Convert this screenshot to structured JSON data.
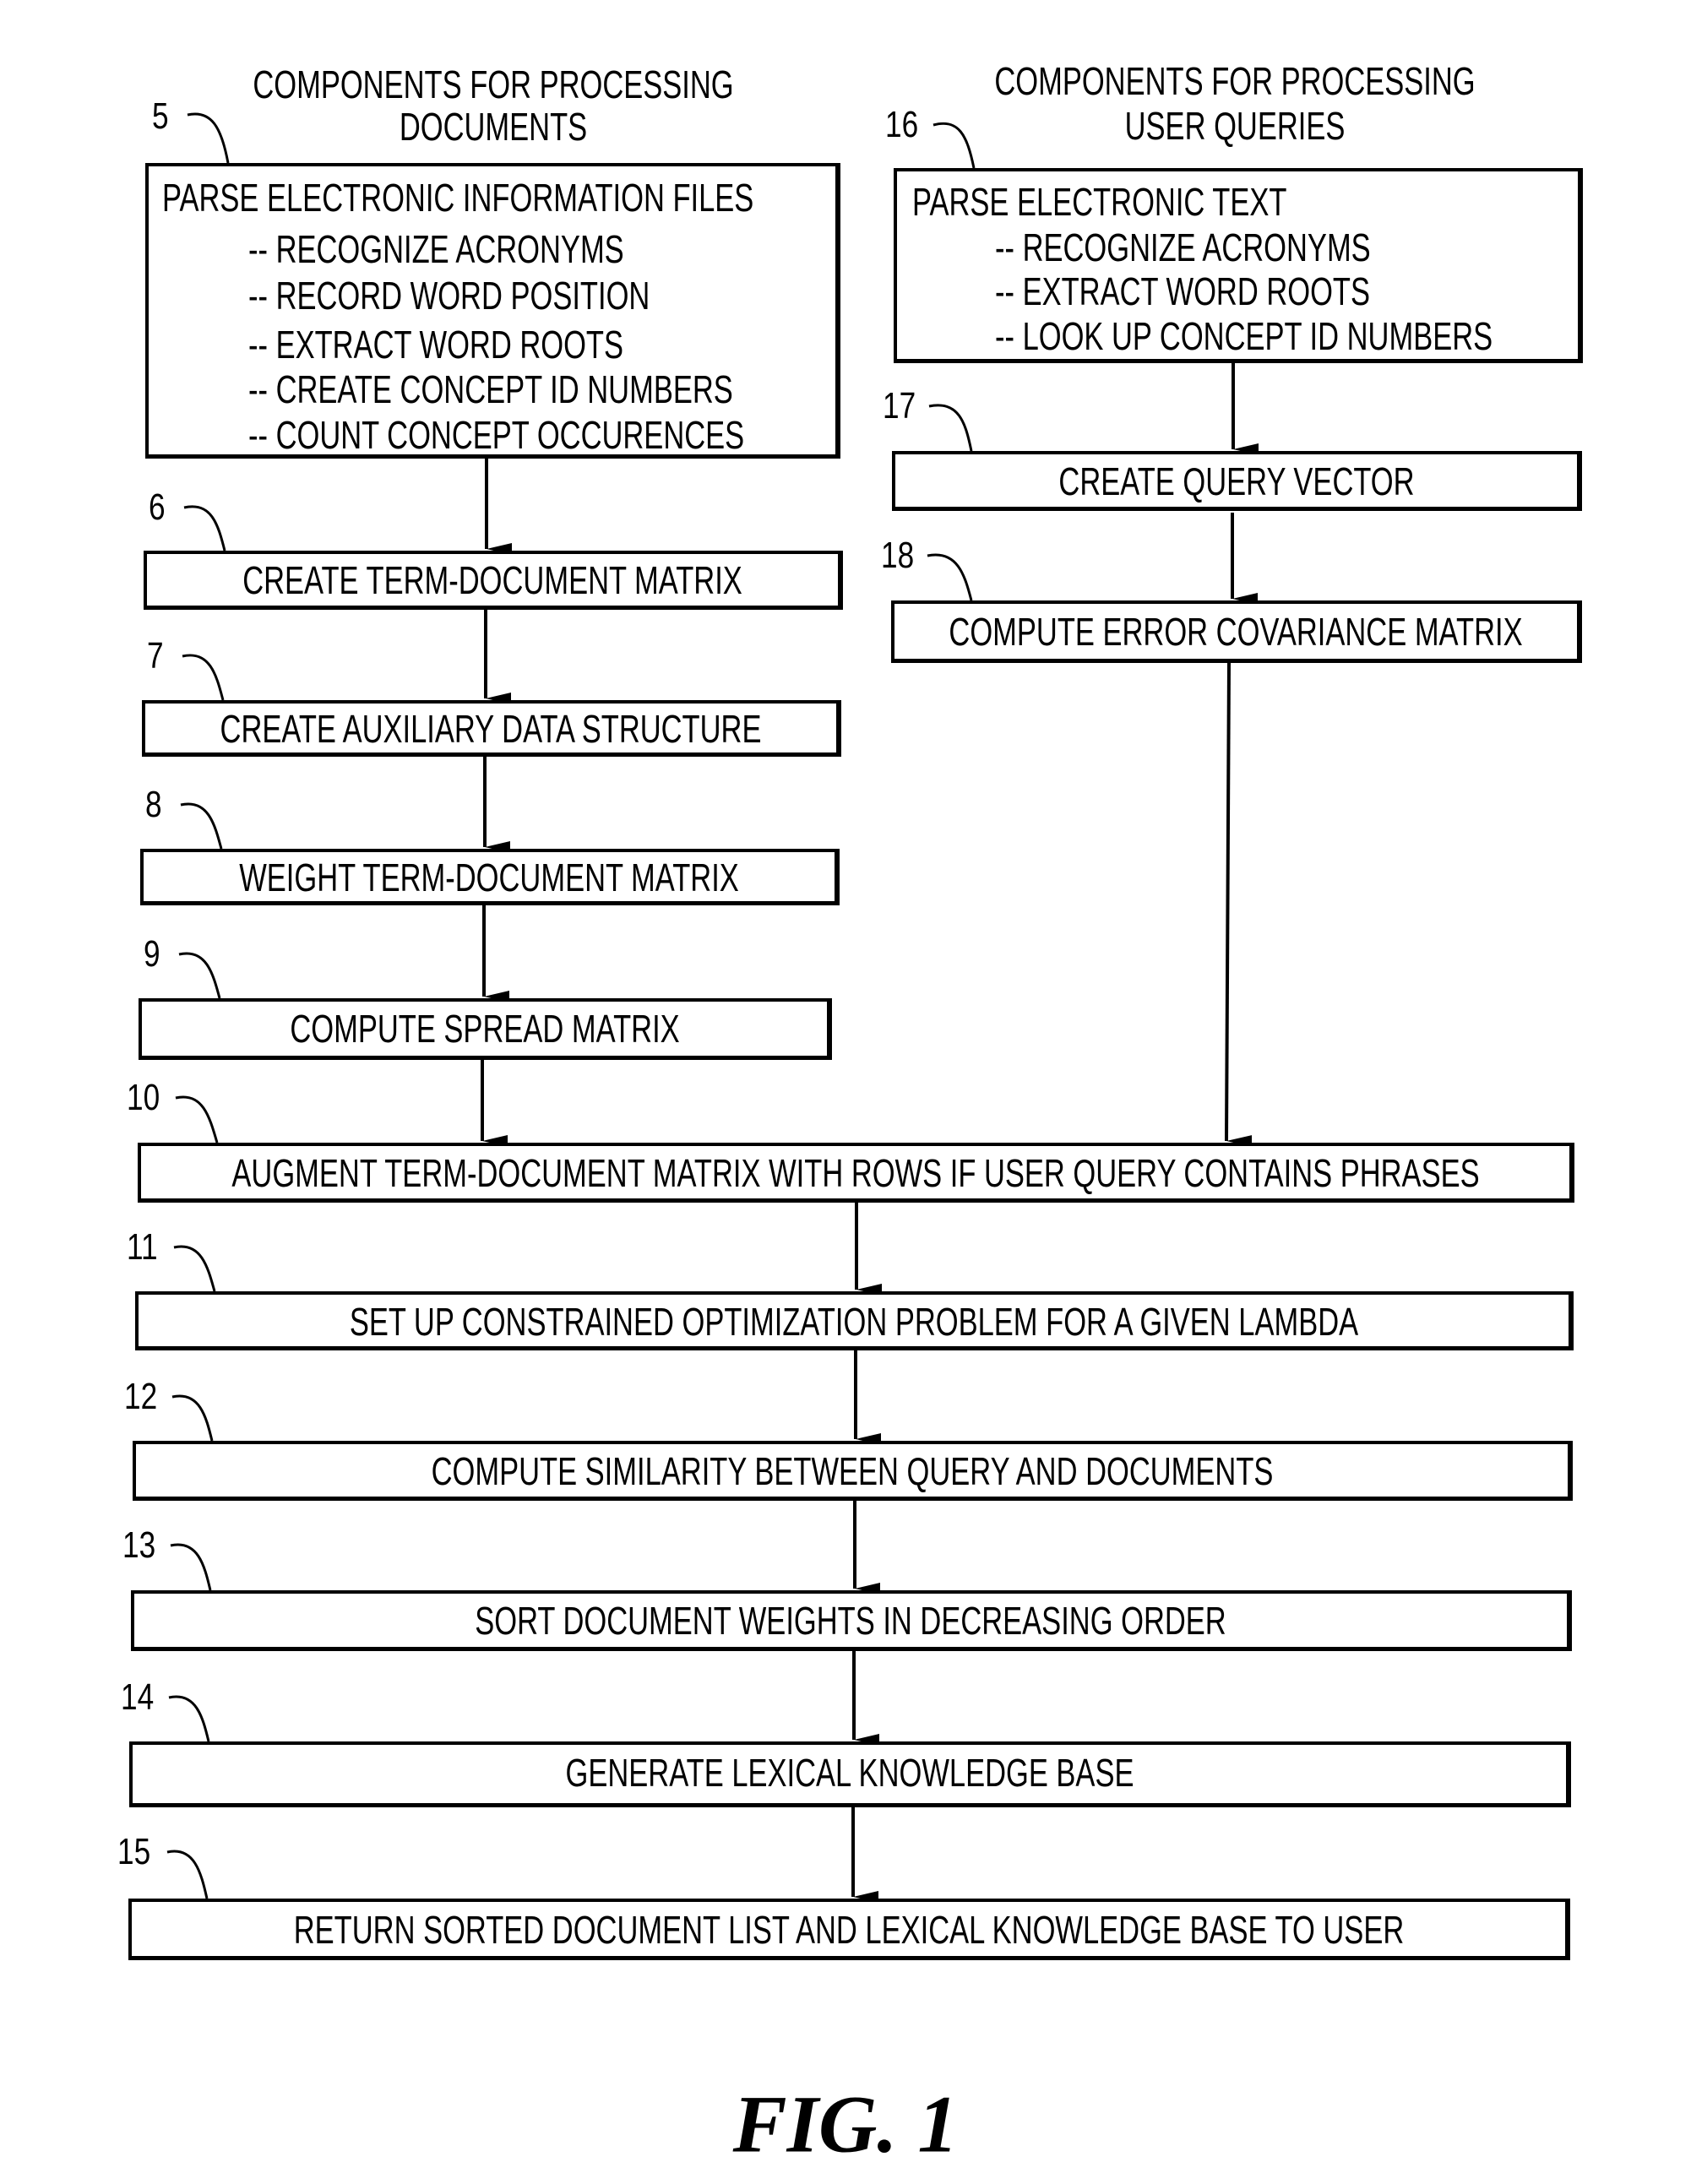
{
  "figure": {
    "caption": "FIG. 1",
    "left_heading": [
      "COMPONENTS FOR PROCESSING",
      "DOCUMENTS"
    ],
    "right_heading": [
      "COMPONENTS FOR PROCESSING",
      "USER QUERIES"
    ]
  },
  "document_steps": [
    {
      "ref": "5",
      "title": "PARSE ELECTRONIC INFORMATION FILES",
      "subitems": [
        "-- RECOGNIZE ACRONYMS",
        "-- RECORD WORD POSITION",
        "-- EXTRACT WORD ROOTS",
        "-- CREATE CONCEPT ID NUMBERS",
        "-- COUNT CONCEPT OCCURENCES"
      ]
    },
    {
      "ref": "6",
      "title": "CREATE TERM-DOCUMENT MATRIX"
    },
    {
      "ref": "7",
      "title": "CREATE AUXILIARY DATA STRUCTURE"
    },
    {
      "ref": "8",
      "title": "WEIGHT TERM-DOCUMENT MATRIX"
    },
    {
      "ref": "9",
      "title": "COMPUTE SPREAD MATRIX"
    }
  ],
  "query_steps": [
    {
      "ref": "16",
      "title": "PARSE ELECTRONIC TEXT",
      "subitems": [
        "-- RECOGNIZE ACRONYMS",
        "-- EXTRACT WORD ROOTS",
        "-- LOOK UP CONCEPT ID NUMBERS"
      ]
    },
    {
      "ref": "17",
      "title": "CREATE QUERY VECTOR"
    },
    {
      "ref": "18",
      "title": "COMPUTE ERROR COVARIANCE MATRIX"
    }
  ],
  "combined_steps": [
    {
      "ref": "10",
      "title": "AUGMENT TERM-DOCUMENT MATRIX WITH ROWS IF USER QUERY CONTAINS PHRASES"
    },
    {
      "ref": "11",
      "title": "SET UP CONSTRAINED OPTIMIZATION PROBLEM FOR A GIVEN LAMBDA"
    },
    {
      "ref": "12",
      "title": "COMPUTE SIMILARITY BETWEEN QUERY AND DOCUMENTS"
    },
    {
      "ref": "13",
      "title": "SORT DOCUMENT WEIGHTS IN DECREASING ORDER"
    },
    {
      "ref": "14",
      "title": "GENERATE LEXICAL KNOWLEDGE BASE"
    },
    {
      "ref": "15",
      "title": "RETURN SORTED DOCUMENT LIST AND LEXICAL KNOWLEDGE BASE TO USER"
    }
  ]
}
